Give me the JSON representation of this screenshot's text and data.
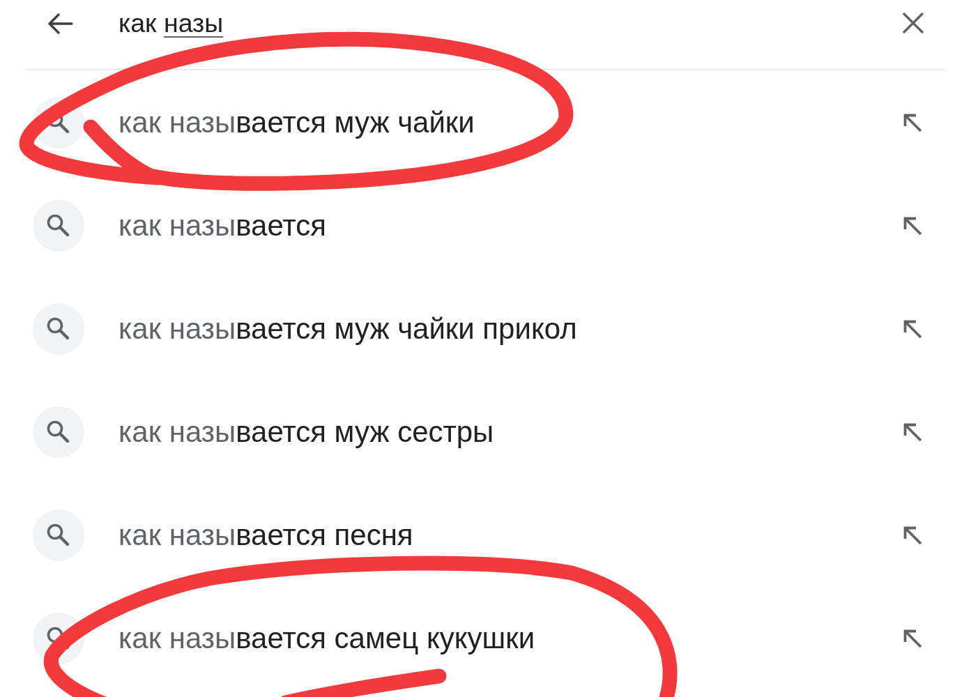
{
  "search": {
    "value": "как назы",
    "composing": true
  },
  "suggestions": [
    {
      "text": "как назы**вается муж чайки**",
      "circled": true
    },
    {
      "text": "как назы**вается**",
      "circled": false
    },
    {
      "text": "как назы**вается муж чайки прикол**",
      "circled": false
    },
    {
      "text": "как назы**вается муж сестры**",
      "circled": false
    },
    {
      "text": "как назы**вается песня**",
      "circled": false
    },
    {
      "text": "как назы**вается самец кукушки**",
      "circled": true
    }
  ]
}
